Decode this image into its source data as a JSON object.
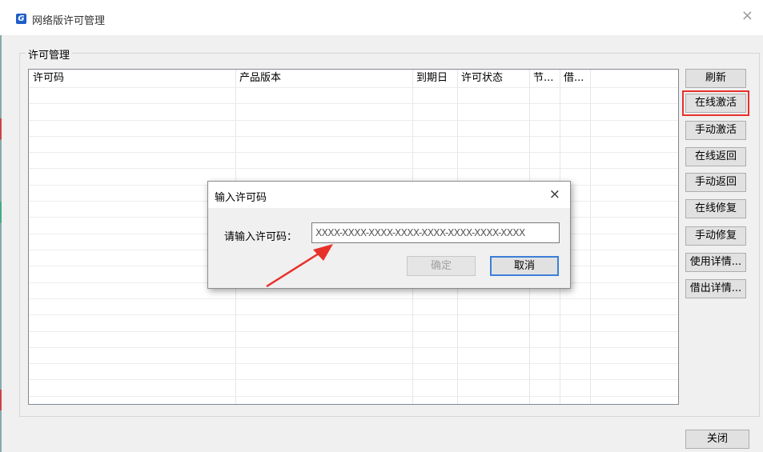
{
  "window": {
    "title": "网络版许可管理",
    "app_icon_letter": "G",
    "close_glyph": "×"
  },
  "group": {
    "label": "许可管理"
  },
  "table": {
    "columns": [
      "许可码",
      "产品版本",
      "到期日",
      "许可状态",
      "节...",
      "借..."
    ],
    "rows": []
  },
  "side_buttons": {
    "refresh": "刷新",
    "online_activate": "在线激活",
    "manual_activate": "手动激活",
    "online_return": "在线返回",
    "manual_return": "手动返回",
    "online_repair": "在线修复",
    "manual_repair": "手动修复",
    "usage_details": "使用详情...",
    "borrow_details": "借出详情..."
  },
  "close_button": "关闭",
  "dialog": {
    "title": "输入许可码",
    "close_glyph": "×",
    "label": "请输入许可码：",
    "placeholder": "XXXX-XXXX-XXXX-XXXX-XXXX-XXXX-XXXX-XXXX",
    "value": "",
    "ok_label": "确定",
    "cancel_label": "取消"
  },
  "colors": {
    "highlight": "#e8302a",
    "accent": "#1e5fc8"
  }
}
